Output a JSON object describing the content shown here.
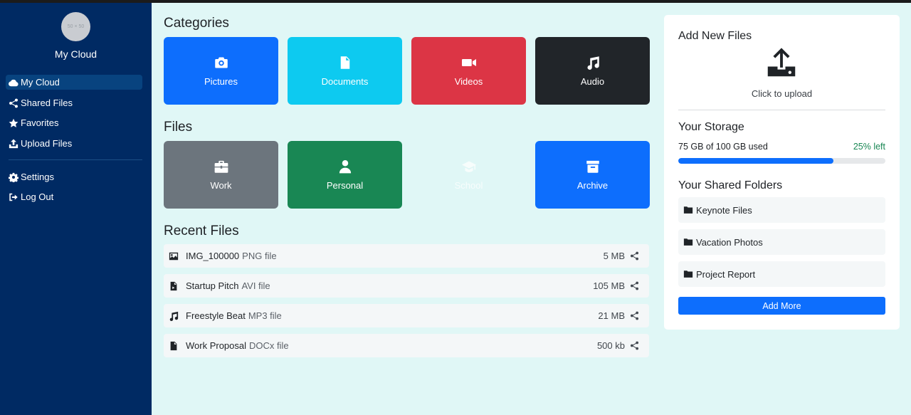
{
  "sidebar": {
    "avatar_placeholder": "50 × 50",
    "brand": "My Cloud",
    "items": [
      {
        "label": "My Cloud",
        "icon": "cloud-icon"
      },
      {
        "label": "Shared Files",
        "icon": "share-icon"
      },
      {
        "label": "Favorites",
        "icon": "star-icon"
      },
      {
        "label": "Upload Files",
        "icon": "upload-icon"
      },
      {
        "label": "Settings",
        "icon": "gear-icon"
      },
      {
        "label": "Log Out",
        "icon": "logout-icon"
      }
    ]
  },
  "categories": {
    "title": "Categories",
    "tiles": [
      {
        "label": "Pictures",
        "icon": "camera-icon",
        "color": "#0d6efd"
      },
      {
        "label": "Documents",
        "icon": "document-icon",
        "color": "#0dcaf0"
      },
      {
        "label": "Videos",
        "icon": "video-icon",
        "color": "#dc3545"
      },
      {
        "label": "Audio",
        "icon": "music-icon",
        "color": "#212529"
      }
    ]
  },
  "files": {
    "title": "Files",
    "tiles": [
      {
        "label": "Work",
        "icon": "briefcase-icon",
        "color": "#6c757d"
      },
      {
        "label": "Personal",
        "icon": "user-icon",
        "color": "#198754"
      },
      {
        "label": "School",
        "icon": "graduation-cap-icon",
        "color": "#f8f9fa"
      },
      {
        "label": "Archive",
        "icon": "archive-icon",
        "color": "#0d6efd"
      }
    ]
  },
  "recent": {
    "title": "Recent Files",
    "rows": [
      {
        "name": "IMG_100000",
        "type": "PNG file",
        "size": "5 MB",
        "icon": "image-icon"
      },
      {
        "name": "Startup Pitch",
        "type": "AVI file",
        "size": "105 MB",
        "icon": "video-file-icon"
      },
      {
        "name": "Freestyle Beat",
        "type": "MP3 file",
        "size": "21 MB",
        "icon": "music-icon"
      },
      {
        "name": "Work Proposal",
        "type": "DOCx file",
        "size": "500 kb",
        "icon": "document-icon"
      }
    ]
  },
  "panel": {
    "add_title": "Add New Files",
    "upload_text": "Click to upload",
    "storage_title": "Your Storage",
    "storage_used": "75 GB of 100 GB used",
    "storage_left": "25% left",
    "storage_fraction": 0.75,
    "shared_title": "Your Shared Folders",
    "folders": [
      "Keynote Files",
      "Vacation Photos",
      "Project Report"
    ],
    "add_more": "Add More"
  }
}
